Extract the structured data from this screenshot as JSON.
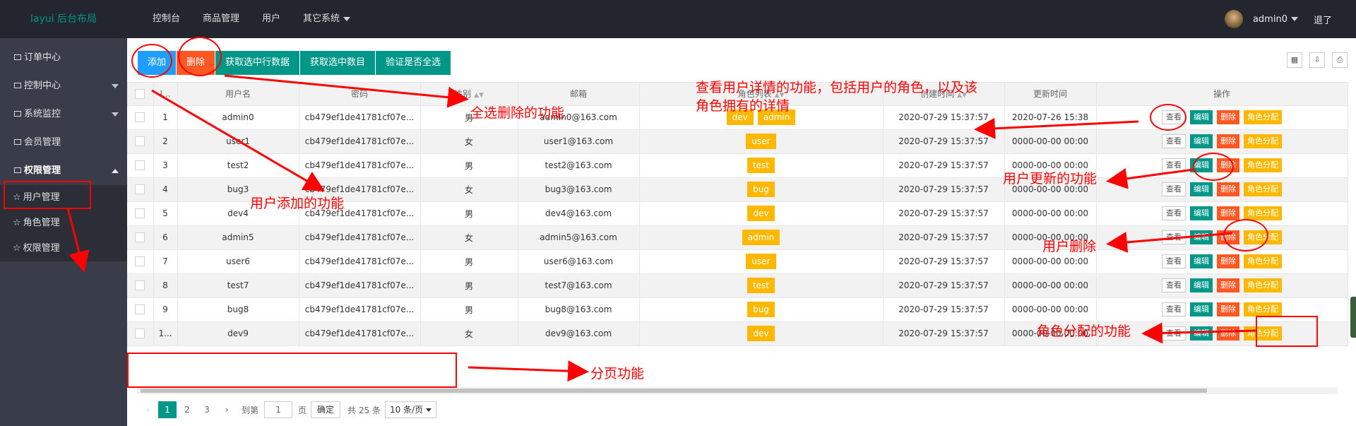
{
  "header": {
    "logo": "layui 后台布局",
    "nav": [
      "控制台",
      "商品管理",
      "用户",
      "其它系统"
    ],
    "username": "admin0",
    "logout": "退了"
  },
  "sidebar": {
    "items": [
      {
        "label": "订单中心",
        "arrow": false
      },
      {
        "label": "控制中心",
        "arrow": true
      },
      {
        "label": "系统监控",
        "arrow": true
      },
      {
        "label": "会员管理",
        "arrow": false
      },
      {
        "label": "权限管理",
        "arrow": "up"
      }
    ],
    "sub_items": [
      "用户管理",
      "角色管理",
      "权限管理"
    ]
  },
  "toolbar": {
    "add": "添加",
    "delete": "删除",
    "get_checked_rows": "获取选中行数据",
    "get_checked_count": "获取选中数目",
    "check_all": "验证是否全选"
  },
  "table": {
    "columns": [
      "I...",
      "用户名",
      "密码",
      "性别",
      "邮箱",
      "角色列表",
      "创建时间",
      "更新时间",
      "操作"
    ],
    "rows": [
      {
        "id": "1",
        "username": "admin0",
        "password": "cb479ef1de41781cf07e...",
        "gender": "男",
        "email": "admin0@163.com",
        "roles": [
          "dev",
          "admin"
        ],
        "created": "2020-07-29 15:37:57",
        "updated": "2020-07-26 15:38"
      },
      {
        "id": "2",
        "username": "user1",
        "password": "cb479ef1de41781cf07e...",
        "gender": "女",
        "email": "user1@163.com",
        "roles": [
          "user"
        ],
        "created": "2020-07-29 15:37:57",
        "updated": "0000-00-00 00:00"
      },
      {
        "id": "3",
        "username": "test2",
        "password": "cb479ef1de41781cf07e...",
        "gender": "男",
        "email": "test2@163.com",
        "roles": [
          "test"
        ],
        "created": "2020-07-29 15:37:57",
        "updated": "0000-00-00 00:00"
      },
      {
        "id": "4",
        "username": "bug3",
        "password": "cb479ef1de41781cf07e...",
        "gender": "女",
        "email": "bug3@163.com",
        "roles": [
          "bug"
        ],
        "created": "2020-07-29 15:37:57",
        "updated": "0000-00-00 00:00"
      },
      {
        "id": "5",
        "username": "dev4",
        "password": "cb479ef1de41781cf07e...",
        "gender": "男",
        "email": "dev4@163.com",
        "roles": [
          "dev"
        ],
        "created": "2020-07-29 15:37:57",
        "updated": "0000-00-00 00:00"
      },
      {
        "id": "6",
        "username": "admin5",
        "password": "cb479ef1de41781cf07e...",
        "gender": "女",
        "email": "admin5@163.com",
        "roles": [
          "admin"
        ],
        "created": "2020-07-29 15:37:57",
        "updated": "0000-00-00 00:00"
      },
      {
        "id": "7",
        "username": "user6",
        "password": "cb479ef1de41781cf07e...",
        "gender": "男",
        "email": "user6@163.com",
        "roles": [
          "user"
        ],
        "created": "2020-07-29 15:37:57",
        "updated": "0000-00-00 00:00"
      },
      {
        "id": "8",
        "username": "test7",
        "password": "cb479ef1de41781cf07e...",
        "gender": "男",
        "email": "test7@163.com",
        "roles": [
          "test"
        ],
        "created": "2020-07-29 15:37:57",
        "updated": "0000-00-00 00:00"
      },
      {
        "id": "9",
        "username": "bug8",
        "password": "cb479ef1de41781cf07e...",
        "gender": "男",
        "email": "bug8@163.com",
        "roles": [
          "bug"
        ],
        "created": "2020-07-29 15:37:57",
        "updated": "0000-00-00 00:00"
      },
      {
        "id": "1...",
        "username": "dev9",
        "password": "cb479ef1de41781cf07e...",
        "gender": "女",
        "email": "dev9@163.com",
        "roles": [
          "dev"
        ],
        "created": "2020-07-29 15:37:57",
        "updated": "0000-00-00 00:00"
      }
    ],
    "actions": [
      "查看",
      "编辑",
      "删除",
      "角色分配"
    ]
  },
  "pager": {
    "prev": "‹",
    "pages": [
      "1",
      "2",
      "3"
    ],
    "current": "1",
    "next": "›",
    "goto_label": "到第",
    "goto_value": "1",
    "page_unit": "页",
    "confirm": "确定",
    "total": "共 25 条",
    "page_size": "10 条/页"
  },
  "annotations": {
    "delete_all": "全选删除的功能",
    "user_detail": "查看用户详情的功能，包括用户的角色，以及该角色拥有的详情",
    "user_add": "用户添加的功能",
    "user_update": "用户更新的功能",
    "user_delete": "用户删除",
    "role_assign": "角色分配的功能",
    "pagination": "分页功能"
  },
  "colors": {
    "header_bg": "#23262e",
    "sidebar_bg": "#393d49",
    "logo": "#009688",
    "primary_blue": "#1e9fff",
    "danger": "#ff5722",
    "teal": "#009688",
    "warning": "#ffb800",
    "annotation": "#ff0000"
  }
}
